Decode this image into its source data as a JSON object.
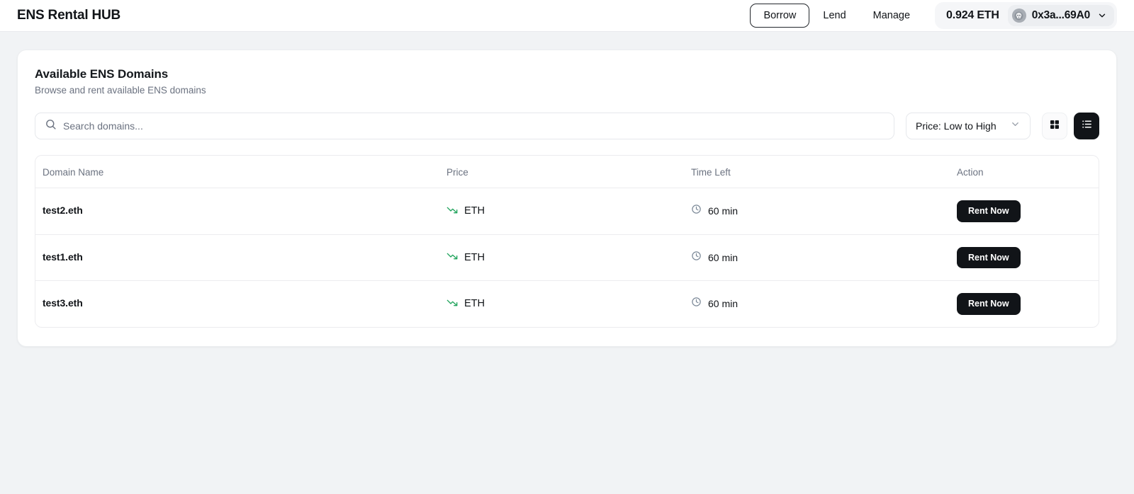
{
  "header": {
    "brand": "ENS Rental HUB",
    "nav": [
      {
        "label": "Borrow",
        "active": true
      },
      {
        "label": "Lend",
        "active": false
      },
      {
        "label": "Manage",
        "active": false
      }
    ],
    "wallet": {
      "balance": "0.924 ETH",
      "address": "0x3a...69A0",
      "avatar_icon": "skull-avatar-icon",
      "chevron_icon": "chevron-down-icon"
    }
  },
  "card": {
    "title": "Available ENS Domains",
    "subtitle": "Browse and rent available ENS domains"
  },
  "toolbar": {
    "search": {
      "placeholder": "Search domains...",
      "value": "",
      "icon": "search-icon"
    },
    "sort": {
      "selected": "Price: Low to High",
      "options": [
        "Price: Low to High"
      ],
      "icon": "chevron-down-icon"
    },
    "view": {
      "grid": {
        "icon": "grid-view-icon",
        "active": false
      },
      "list": {
        "icon": "list-view-icon",
        "active": true
      }
    }
  },
  "table": {
    "columns": [
      "Domain Name",
      "Price",
      "Time Left",
      "Action"
    ],
    "rows": [
      {
        "domain": "test2.eth",
        "price": "ETH",
        "price_icon": "trending-down-icon",
        "time_left": "60 min",
        "time_icon": "clock-icon",
        "action": "Rent Now"
      },
      {
        "domain": "test1.eth",
        "price": "ETH",
        "price_icon": "trending-down-icon",
        "time_left": "60 min",
        "time_icon": "clock-icon",
        "action": "Rent Now"
      },
      {
        "domain": "test3.eth",
        "price": "ETH",
        "price_icon": "trending-down-icon",
        "time_left": "60 min",
        "time_icon": "clock-icon",
        "action": "Rent Now"
      }
    ]
  },
  "colors": {
    "page_background": "#f1f3f5",
    "card_background": "#ffffff",
    "accent_dark": "#111418",
    "price_green": "#22a45d",
    "clock_blue": "#7d8a99",
    "muted_text": "#6b7280"
  }
}
